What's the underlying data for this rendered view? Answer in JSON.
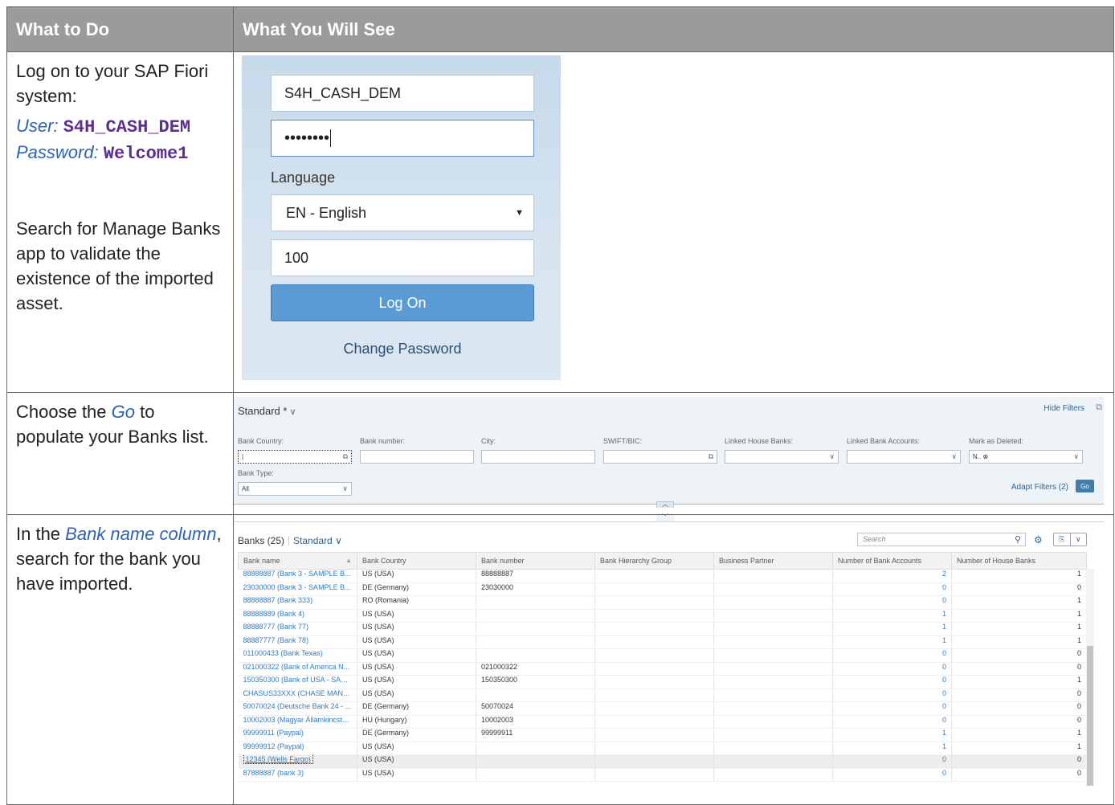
{
  "headers": {
    "col1": "What to Do",
    "col2": "What You Will See"
  },
  "step1": {
    "line1": "Log on to your SAP Fiori system:",
    "user_label": "User:",
    "user_value": "S4H_CASH_DEM",
    "password_label": "Password:",
    "password_value": "Welcome1",
    "line2": "Search for Manage Banks app to validate the existence of the imported asset."
  },
  "login": {
    "user": "S4H_CASH_DEM",
    "password_mask": "••••••••",
    "language_label": "Language",
    "language_value": "EN - English",
    "client": "100",
    "logon_button": "Log On",
    "change_password": "Change Password"
  },
  "step2": {
    "pre": "Choose the ",
    "go": "Go",
    "post": " to populate your Banks list."
  },
  "filter_bar": {
    "variant": "Standard *",
    "hide_filters": "Hide Filters",
    "fields": [
      {
        "label": "Bank Country:",
        "value": "|"
      },
      {
        "label": "Bank number:",
        "value": ""
      },
      {
        "label": "City:",
        "value": ""
      },
      {
        "label": "SWIFT/BIC:",
        "value": ""
      },
      {
        "label": "Linked House Banks:",
        "value": ""
      },
      {
        "label": "Linked Bank Accounts:",
        "value": ""
      },
      {
        "label": "Mark as Deleted:",
        "value": "N.. ⊗"
      }
    ],
    "bank_type_label": "Bank Type:",
    "bank_type_value": "All",
    "adapt_filters": "Adapt Filters (2)",
    "go_button": "Go"
  },
  "step3": {
    "pre": "In the ",
    "col": "Bank name column",
    "post": ", search for the bank you have imported."
  },
  "banks": {
    "title": "Banks (25)",
    "variant": "Standard",
    "search_placeholder": "Search",
    "columns": [
      "Bank name",
      "Bank Country",
      "Bank number",
      "Bank Hierarchy Group",
      "Business Partner",
      "Number of Bank Accounts",
      "Number of House Banks"
    ],
    "rows": [
      [
        "88888887 (Bank 3 - SAMPLE B...",
        "US (USA)",
        "88888887",
        "",
        "",
        "2",
        "1"
      ],
      [
        "23030000 (Bank 3 - SAMPLE B...",
        "DE (Germany)",
        "23030000",
        "",
        "",
        "0",
        "0"
      ],
      [
        "88888887 (Bank 333)",
        "RO (Romania)",
        "",
        "",
        "",
        "0",
        "1"
      ],
      [
        "88888889 (Bank 4)",
        "US (USA)",
        "",
        "",
        "",
        "1",
        "1"
      ],
      [
        "88888777 (Bank 77)",
        "US (USA)",
        "",
        "",
        "",
        "1",
        "1"
      ],
      [
        "88887777 (Bank 78)",
        "US (USA)",
        "",
        "",
        "",
        "1",
        "1"
      ],
      [
        "011000433 (Bank Texas)",
        "US (USA)",
        "",
        "",
        "",
        "0",
        "0"
      ],
      [
        "021000322 (Bank of America N...",
        "US (USA)",
        "021000322",
        "",
        "",
        "0",
        "0"
      ],
      [
        "150350300 (Bank of USA - SAM...",
        "US (USA)",
        "150350300",
        "",
        "",
        "0",
        "1"
      ],
      [
        "CHASUS33XXX (CHASE MANH...",
        "US (USA)",
        "",
        "",
        "",
        "0",
        "0"
      ],
      [
        "50070024 (Deutsche Bank 24 - ...",
        "DE (Germany)",
        "50070024",
        "",
        "",
        "0",
        "0"
      ],
      [
        "10002003 (Magyar Államkincstá...",
        "HU (Hungary)",
        "10002003",
        "",
        "",
        "0",
        "0"
      ],
      [
        "99999911 (Paypal)",
        "DE (Germany)",
        "99999911",
        "",
        "",
        "1",
        "1"
      ],
      [
        "99999912 (Paypal)",
        "US (USA)",
        "",
        "",
        "",
        "1",
        "1"
      ],
      [
        "12345 (Wells Fargo)",
        "US (USA)",
        "",
        "",
        "",
        "0",
        "0"
      ],
      [
        "87888887 (bank 3)",
        "US (USA)",
        "",
        "",
        "",
        "0",
        "0"
      ]
    ],
    "selected_row": 14
  }
}
